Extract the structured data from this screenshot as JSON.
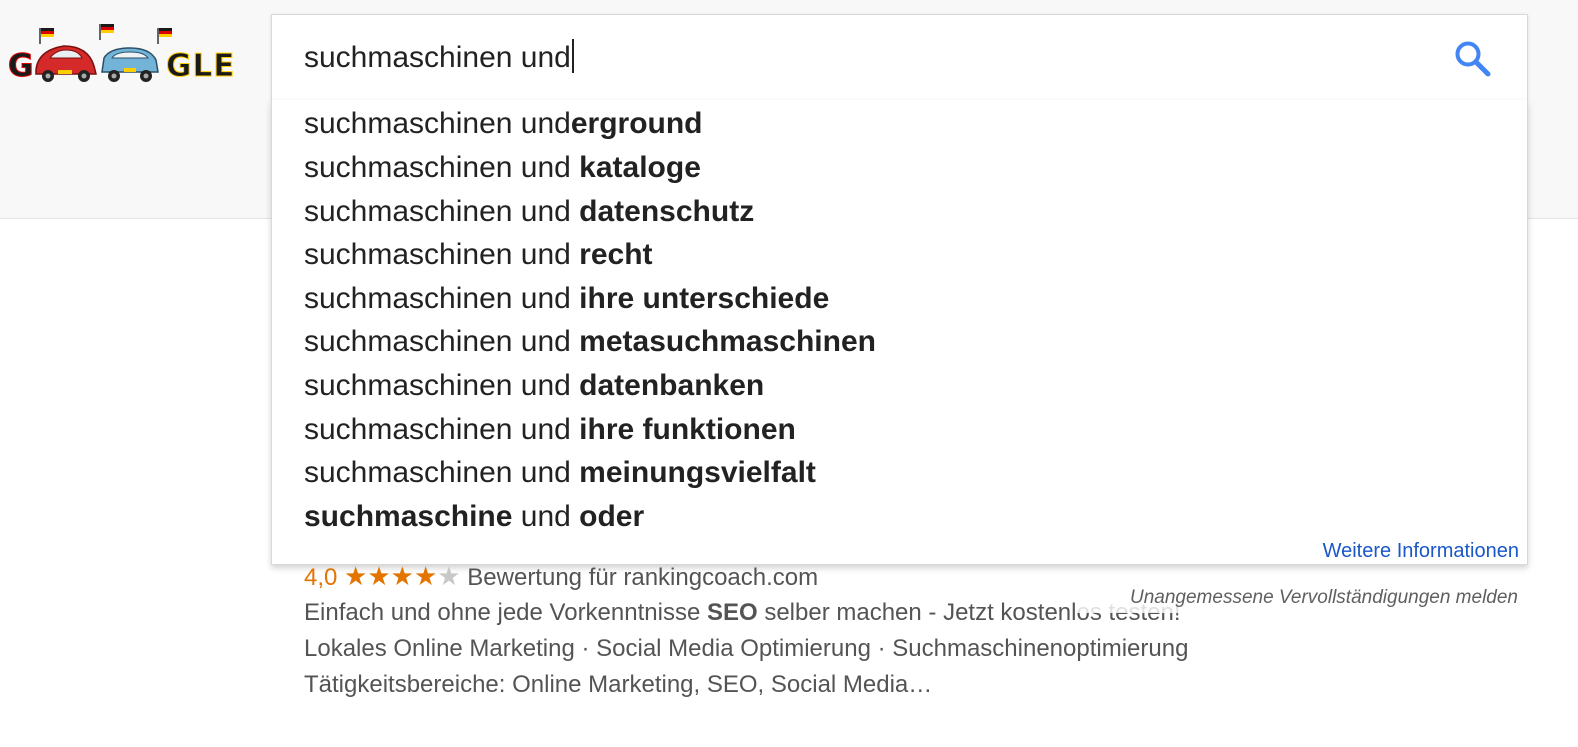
{
  "logo": {
    "letters_left": "G",
    "letters_right": "GLE",
    "colors": {
      "black": "#1a1a1a",
      "red": "#dd0000",
      "gold": "#ffce00",
      "car_red": "#d62a2a",
      "car_blue": "#74b3d8"
    }
  },
  "search": {
    "query": "suchmaschinen und",
    "icon": "search-icon",
    "icon_color": "#4285f4"
  },
  "suggestions": [
    {
      "prefix": "suchmaschinen und",
      "bold": "erground",
      "bold_first": false,
      "joiner": ""
    },
    {
      "prefix": "suchmaschinen und ",
      "bold": "kataloge",
      "bold_first": false,
      "joiner": ""
    },
    {
      "prefix": "suchmaschinen und ",
      "bold": "datenschutz",
      "bold_first": false,
      "joiner": ""
    },
    {
      "prefix": "suchmaschinen und ",
      "bold": "recht",
      "bold_first": false,
      "joiner": ""
    },
    {
      "prefix": "suchmaschinen und ",
      "bold": "ihre unterschiede",
      "bold_first": false,
      "joiner": ""
    },
    {
      "prefix": "suchmaschinen und ",
      "bold": "metasuchmaschinen",
      "bold_first": false,
      "joiner": ""
    },
    {
      "prefix": "suchmaschinen und ",
      "bold": "datenbanken",
      "bold_first": false,
      "joiner": ""
    },
    {
      "prefix": "suchmaschinen und ",
      "bold": "ihre funktionen",
      "bold_first": false,
      "joiner": ""
    },
    {
      "prefix": "suchmaschinen und ",
      "bold": "meinungsvielfalt",
      "bold_first": false,
      "joiner": ""
    }
  ],
  "last_suggestion": {
    "bold1": "suchmaschine",
    "middle": " und ",
    "bold2": "oder"
  },
  "more_info": "Weitere Informationen",
  "report_link": "Unangemessene Vervollständigungen melden",
  "result": {
    "rating_value": "4,0",
    "stars_filled": 4,
    "stars_total": 5,
    "rating_text": "Bewertung für rankingcoach.com",
    "desc_before": "Einfach und ohne jede Vorkenntnisse ",
    "desc_bold": "SEO",
    "desc_after": " selber machen - Jetzt kostenlos testen!",
    "links_line": "Lokales Online Marketing · Social Media Optimierung · Suchmaschinenoptimierung",
    "areas_line": "Tätigkeitsbereiche: Online Marketing, SEO, Social Media…"
  }
}
